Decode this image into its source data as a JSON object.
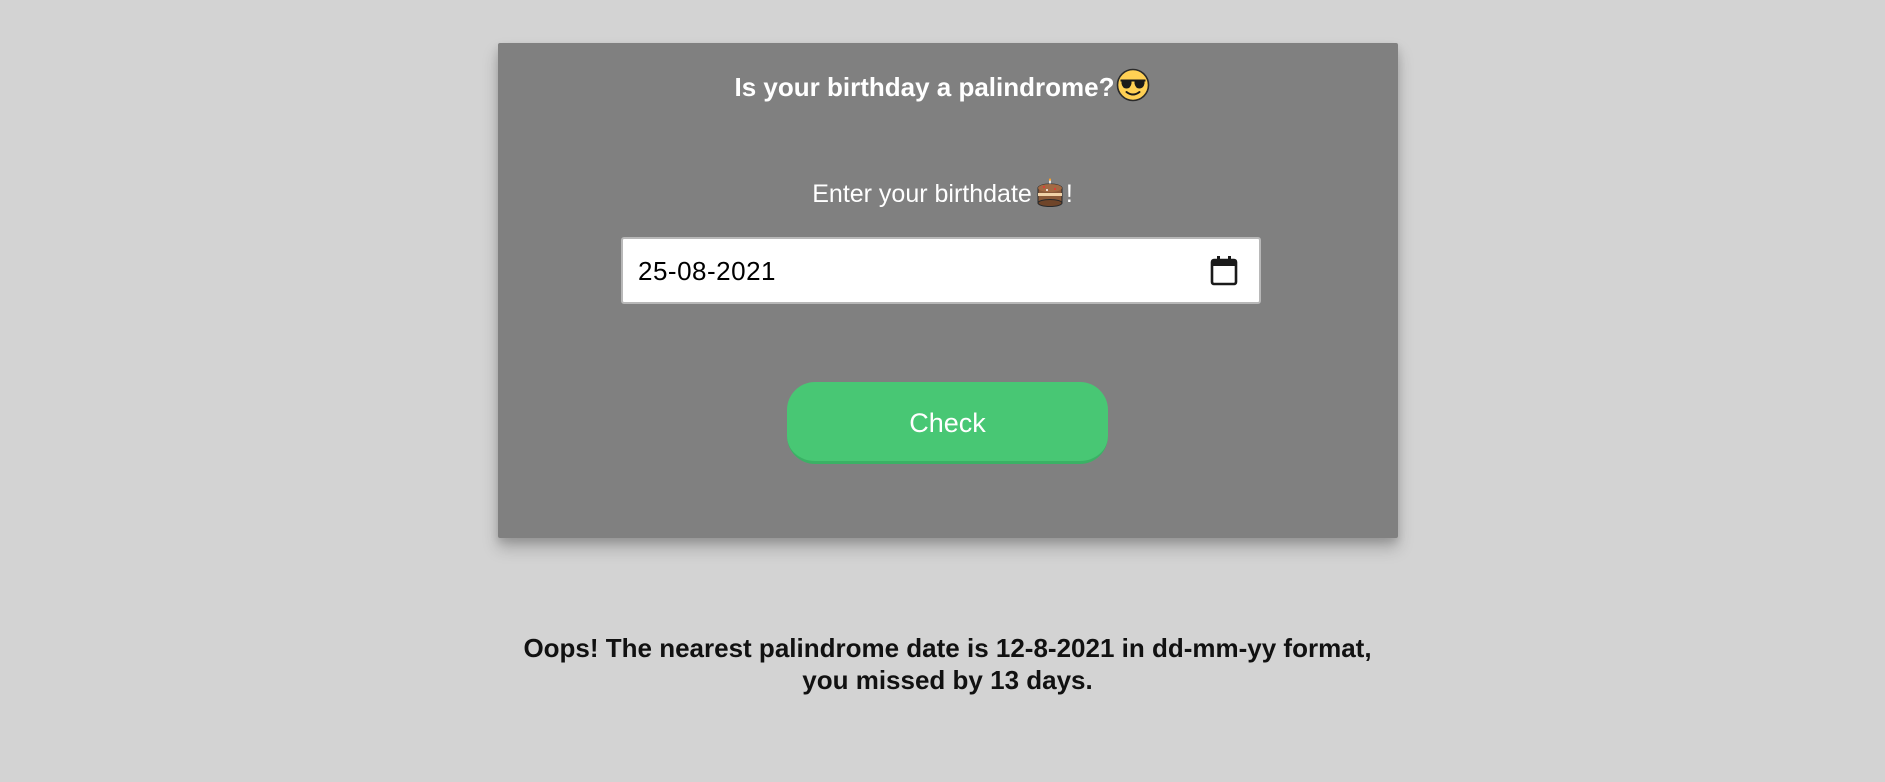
{
  "app": {
    "title": "Is your birthday a palindrome?",
    "title_emoji": "sunglasses-face-icon"
  },
  "form": {
    "prompt_label": "Enter your birthdate",
    "prompt_emoji": "birthday-cake-icon",
    "prompt_suffix": "!",
    "date_value": "25-08-2021",
    "calendar_icon": "calendar-icon",
    "check_label": "Check"
  },
  "result": {
    "message": "Oops! The nearest palindrome date is 12-8-2021 in dd-mm-yy format, you missed by 13 days."
  },
  "colors": {
    "page_background": "#d3d3d3",
    "card_background": "#808080",
    "button": "#48c774",
    "text_light": "#ffffff",
    "text_dark": "#111111"
  }
}
